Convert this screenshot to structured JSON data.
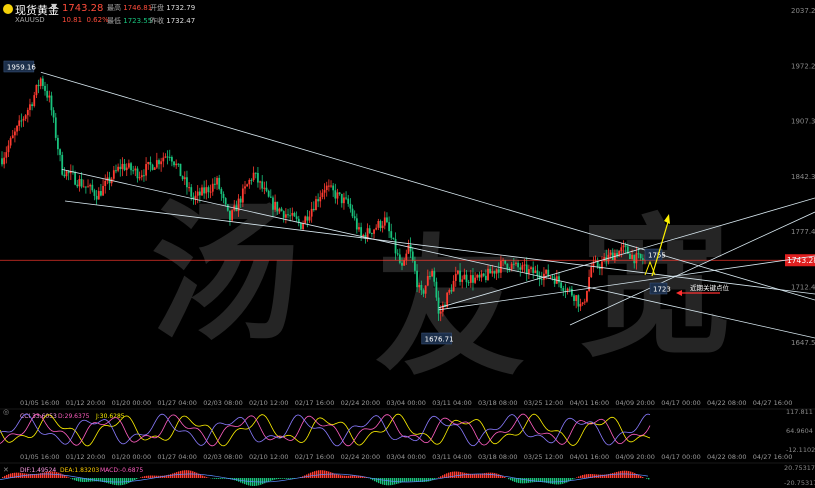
{
  "header": {
    "name": "现货黄金",
    "code": "XAUUSD",
    "price": "1743.28",
    "change": "10.81",
    "change_pct": "0.62%",
    "high_label": "最高",
    "high": "1746.81",
    "open_label": "开盘",
    "open": "1732.79",
    "low_label": "最低",
    "low": "1723.55",
    "prev_label": "昨收",
    "prev": "1732.47"
  },
  "colors": {
    "up": "#ff3b30",
    "down": "#19c37d",
    "line": "#d8e8f0",
    "price_line": "#ff3b30"
  },
  "watermark": "汤 友 宽",
  "chart_data": {
    "type": "candlestick",
    "price_axis": {
      "ticks": [
        2037.21,
        1972.26,
        1907.31,
        1842.36,
        1777.41,
        1712.46,
        1647.51
      ],
      "range": [
        1612,
        2037.21
      ]
    },
    "date_ticks_main": [
      "01/05 16:00",
      "01/12 20:00",
      "01/20 00:00",
      "01/27 04:00",
      "02/03 08:00",
      "02/10 12:00",
      "02/17 16:00",
      "02/24 20:00",
      "03/04 00:00",
      "03/11 04:00",
      "03/18 08:00",
      "03/25 12:00",
      "04/01 16:00",
      "04/09 20:00",
      "04/17 00:00",
      "04/22 08:00",
      "04/27 16:00"
    ],
    "date_ticks_sub": [
      "01/05 16:00",
      "01/12 20:00",
      "01/20 00:00",
      "01/27 04:00",
      "02/03 08:00",
      "02/10 12:00",
      "02/17 16:00",
      "02/24 20:00",
      "03/04 00:00",
      "03/11 04:00",
      "03/18 08:00",
      "03/25 12:00",
      "04/01 16:00",
      "04/09 20:00",
      "04/17 00:00",
      "04/22 08:00",
      "04/27 16:00"
    ],
    "current_price": "1743.28",
    "callouts": {
      "high": "1959.16",
      "low": "1676.71",
      "up_target": "1755",
      "down_target": "1723",
      "note": "近期关键点位"
    },
    "path": [
      [
        0,
        1863
      ],
      [
        0.05,
        1930
      ],
      [
        0.065,
        1957
      ],
      [
        0.08,
        1930
      ],
      [
        0.1,
        1850
      ],
      [
        0.16,
        1820
      ],
      [
        0.2,
        1855
      ],
      [
        0.23,
        1845
      ],
      [
        0.28,
        1870
      ],
      [
        0.32,
        1815
      ],
      [
        0.36,
        1835
      ],
      [
        0.38,
        1790
      ],
      [
        0.42,
        1845
      ],
      [
        0.45,
        1810
      ],
      [
        0.5,
        1785
      ],
      [
        0.54,
        1830
      ],
      [
        0.58,
        1808
      ],
      [
        0.6,
        1770
      ],
      [
        0.64,
        1790
      ],
      [
        0.67,
        1730
      ],
      [
        0.68,
        1760
      ],
      [
        0.7,
        1700
      ],
      [
        0.72,
        1735
      ],
      [
        0.73,
        1678
      ],
      [
        0.76,
        1725
      ],
      [
        0.8,
        1720
      ],
      [
        0.84,
        1740
      ],
      [
        0.88,
        1730
      ],
      [
        0.92,
        1725
      ],
      [
        0.96,
        1700
      ],
      [
        0.97,
        1685
      ],
      [
        0.985,
        1735
      ],
      [
        1,
        1738
      ],
      [
        1.02,
        1750
      ],
      [
        1.04,
        1756
      ],
      [
        1.06,
        1745
      ],
      [
        1.075,
        1743
      ]
    ],
    "oscillator": {
      "labels": [
        "CCI 33.6053",
        "D:29.6375",
        "J:30.6285"
      ],
      "ticks": [
        "117.811",
        "64.9604",
        "-12.1102"
      ]
    },
    "macd": {
      "labels": [
        "DIF:1.49524",
        "DEA:1.83203",
        "MACD:-0.6875"
      ],
      "ticks": [
        "20.75317",
        "-20.75317"
      ]
    }
  }
}
